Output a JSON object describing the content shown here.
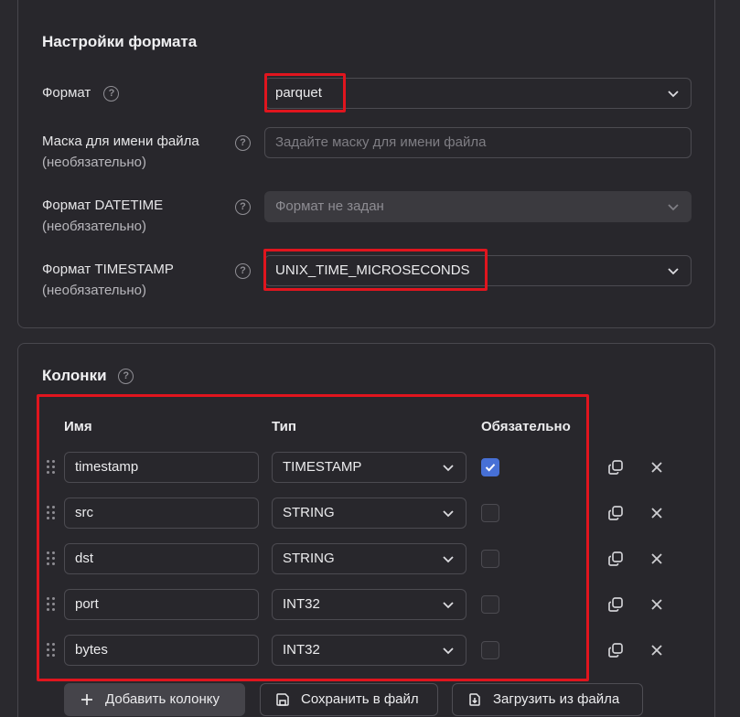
{
  "format_settings": {
    "title": "Настройки формата",
    "format": {
      "label": "Формат",
      "value": "parquet"
    },
    "file_mask": {
      "label": "Маска для имени файла",
      "optional": "(необязательно)",
      "placeholder": "Задайте маску для имени файла"
    },
    "datetime": {
      "label": "Формат DATETIME",
      "optional": "(необязательно)",
      "value": "Формат не задан"
    },
    "timestamp": {
      "label": "Формат TIMESTAMP",
      "optional": "(необязательно)",
      "value": "UNIX_TIME_MICROSECONDS"
    }
  },
  "columns": {
    "title": "Колонки",
    "headers": {
      "name": "Имя",
      "type": "Тип",
      "required": "Обязательно"
    },
    "rows": [
      {
        "name": "timestamp",
        "type": "TIMESTAMP",
        "required": true
      },
      {
        "name": "src",
        "type": "STRING",
        "required": false
      },
      {
        "name": "dst",
        "type": "STRING",
        "required": false
      },
      {
        "name": "port",
        "type": "INT32",
        "required": false
      },
      {
        "name": "bytes",
        "type": "INT32",
        "required": false
      }
    ],
    "buttons": {
      "add": "Добавить колонку",
      "save": "Сохранить в файл",
      "load": "Загрузить из файла"
    }
  },
  "colors": {
    "background": "#2a292e",
    "highlight": "#e0151e",
    "checkbox_checked": "#4770d6"
  },
  "help_glyph": "?"
}
